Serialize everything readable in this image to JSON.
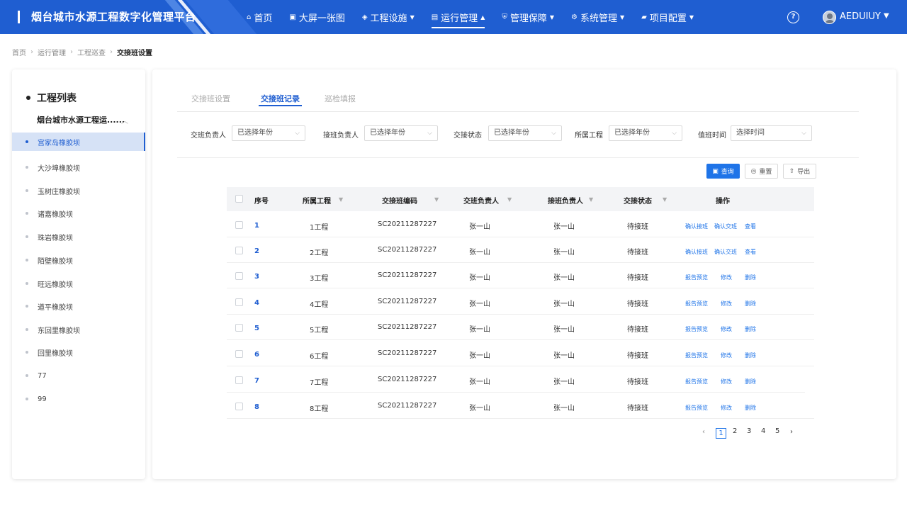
{
  "header": {
    "title": "烟台城市水源工程数字化管理平台",
    "nav": [
      {
        "label": "首页",
        "icon": "home-icon",
        "glyph": "⌂",
        "caret": false,
        "active": false
      },
      {
        "label": "大屏一张图",
        "icon": "screen-icon",
        "glyph": "▣",
        "caret": false,
        "active": false
      },
      {
        "label": "工程设施",
        "icon": "layers-icon",
        "glyph": "◈",
        "caret": true,
        "active": false
      },
      {
        "label": "运行管理",
        "icon": "document-icon",
        "glyph": "▤",
        "caret": true,
        "active": true
      },
      {
        "label": "管理保障",
        "icon": "shield-icon",
        "glyph": "⛨",
        "caret": true,
        "active": false
      },
      {
        "label": "系统管理",
        "icon": "gear-icon",
        "glyph": "⚙",
        "caret": true,
        "active": false
      },
      {
        "label": "项目配置",
        "icon": "folder-icon",
        "glyph": "▰",
        "caret": true,
        "active": false
      }
    ],
    "help_glyph": "?",
    "username": "AEDUIUY"
  },
  "breadcrumb": [
    "首页",
    "运行管理",
    "工程巡查",
    "交接班设置"
  ],
  "sidebar": {
    "title": "工程列表",
    "group": "烟台城市水源工程运......",
    "items": [
      {
        "label": "宫家岛橡胶坝",
        "selected": true
      },
      {
        "label": "大沙埠橡胶坝",
        "selected": false
      },
      {
        "label": "玉树庄橡胶坝",
        "selected": false
      },
      {
        "label": "诸嘉橡胶坝",
        "selected": false
      },
      {
        "label": "珠岩橡胶坝",
        "selected": false
      },
      {
        "label": "陌壁橡胶坝",
        "selected": false
      },
      {
        "label": "旺远橡胶坝",
        "selected": false
      },
      {
        "label": "道平橡胶坝",
        "selected": false
      },
      {
        "label": "东回里橡胶坝",
        "selected": false
      },
      {
        "label": "回里橡胶坝",
        "selected": false
      },
      {
        "label": "77",
        "selected": false
      },
      {
        "label": "99",
        "selected": false
      }
    ]
  },
  "tabs": [
    {
      "label": "交接班设置",
      "active": false
    },
    {
      "label": "交接班记录",
      "active": true
    },
    {
      "label": "巡检填报",
      "active": false
    }
  ],
  "filters": [
    {
      "label": "交班负责人",
      "value": "已选择年份"
    },
    {
      "label": "接班负责人",
      "value": "已选择年份"
    },
    {
      "label": "交接状态",
      "value": "已选择年份"
    },
    {
      "label": "所属工程",
      "value": "已选择年份"
    },
    {
      "label": "值班时间",
      "value": "选择时间"
    }
  ],
  "actions": {
    "query": "查询",
    "reset": "重置",
    "export": "导出"
  },
  "table": {
    "columns": [
      "序号",
      "所属工程",
      "交接班编码",
      "交班负责人",
      "接班负责人",
      "交接状态",
      "操作"
    ],
    "rows": [
      {
        "idx": "1",
        "project": "1工程",
        "code": "SC20211287227",
        "handover": "张一山",
        "takeover": "张一山",
        "status": "待接班",
        "ops": [
          "确认接班",
          "确认交班",
          "查看"
        ]
      },
      {
        "idx": "2",
        "project": "2工程",
        "code": "SC20211287227",
        "handover": "张一山",
        "takeover": "张一山",
        "status": "待接班",
        "ops": [
          "确认接班",
          "确认交班",
          "查看"
        ]
      },
      {
        "idx": "3",
        "project": "3工程",
        "code": "SC20211287227",
        "handover": "张一山",
        "takeover": "张一山",
        "status": "待接班",
        "ops": [
          "报告预览",
          "修改",
          "删除"
        ]
      },
      {
        "idx": "4",
        "project": "4工程",
        "code": "SC20211287227",
        "handover": "张一山",
        "takeover": "张一山",
        "status": "待接班",
        "ops": [
          "报告预览",
          "修改",
          "删除"
        ]
      },
      {
        "idx": "5",
        "project": "5工程",
        "code": "SC20211287227",
        "handover": "张一山",
        "takeover": "张一山",
        "status": "待接班",
        "ops": [
          "报告预览",
          "修改",
          "删除"
        ]
      },
      {
        "idx": "6",
        "project": "6工程",
        "code": "SC20211287227",
        "handover": "张一山",
        "takeover": "张一山",
        "status": "待接班",
        "ops": [
          "报告预览",
          "修改",
          "删除"
        ]
      },
      {
        "idx": "7",
        "project": "7工程",
        "code": "SC20211287227",
        "handover": "张一山",
        "takeover": "张一山",
        "status": "待接班",
        "ops": [
          "报告预览",
          "修改",
          "删除"
        ]
      },
      {
        "idx": "8",
        "project": "8工程",
        "code": "SC20211287227",
        "handover": "张一山",
        "takeover": "张一山",
        "status": "待接班",
        "ops": [
          "报告预览",
          "修改",
          "删除"
        ]
      }
    ]
  },
  "pagination": {
    "pages": [
      "1",
      "2",
      "3",
      "4",
      "5"
    ],
    "current": "1"
  },
  "colors": {
    "primary": "#1f5ed1",
    "accent": "#1f74e8",
    "selected_bg": "#d6e2f6"
  }
}
